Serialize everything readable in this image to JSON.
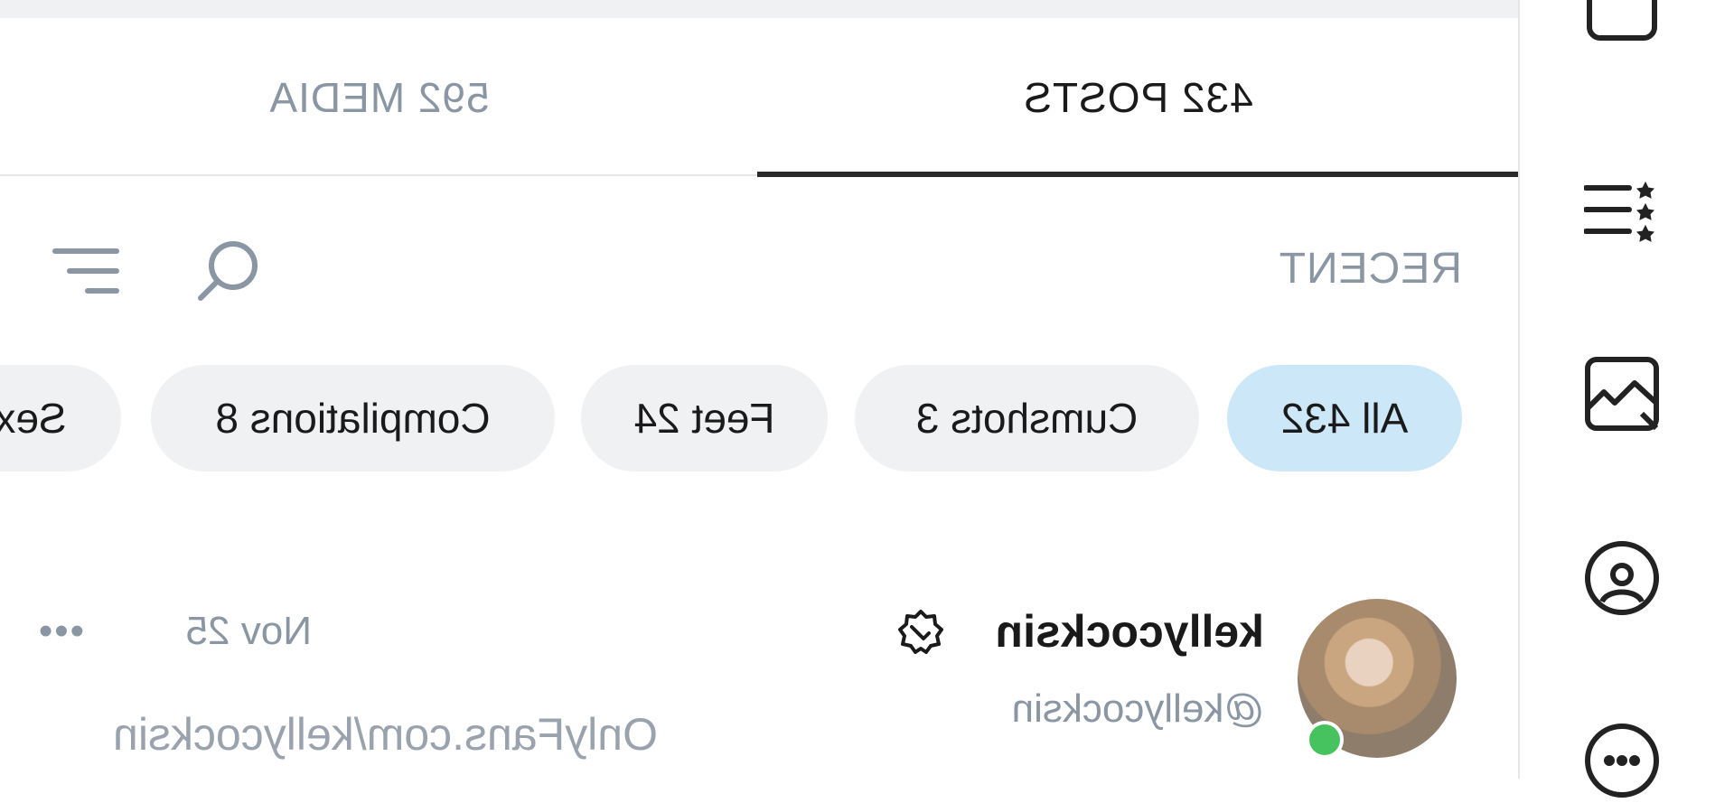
{
  "tabs": {
    "posts_label": "432 POSTS",
    "media_label": "592 MEDIA"
  },
  "filter": {
    "sort_label": "RECENT"
  },
  "chips": [
    {
      "label": "All 432",
      "active": true
    },
    {
      "label": "Cumshots 3",
      "active": false
    },
    {
      "label": "Feet 24",
      "active": false
    },
    {
      "label": "Compilations 8",
      "active": false
    },
    {
      "label": "Sex",
      "active": false
    }
  ],
  "post": {
    "display_name": "kellycocksin",
    "handle": "@kellycocksin",
    "date": "Nov 25",
    "more": "•••",
    "text": "OnlyFans.com/kellycocksin"
  },
  "colors": {
    "accent_chip": "#cce7f7",
    "chip_bg": "#f0f1f3",
    "muted_text": "#8a96a3",
    "online": "#46c35f"
  },
  "rail_icons": [
    "calendar-icon",
    "star-list-icon",
    "image-icon",
    "profile-icon",
    "chat-icon"
  ]
}
